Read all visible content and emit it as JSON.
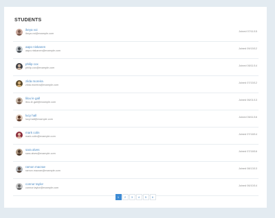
{
  "title": "STUDENTS",
  "students": [
    {
      "name": "ikeya voi",
      "email": "ikeya.voi@example.com",
      "joined": "Joined 07/11/15",
      "avatar_bg": "#c9a89c",
      "avatar_fg": "#7a5a4e"
    },
    {
      "name": "aapo niskanen",
      "email": "aapo.niskanen@example.com",
      "joined": "Joined 09/15/12",
      "avatar_bg": "#c3c8cc",
      "avatar_fg": "#4c5258"
    },
    {
      "name": "philip cox",
      "email": "philip.cox@example.com",
      "joined": "Joined 06/11/14",
      "avatar_bg": "#3e3f43",
      "avatar_fg": "#c9b09c"
    },
    {
      "name": "zilda moreira",
      "email": "zilda.moreira@example.com",
      "joined": "Joined 07/15/12",
      "avatar_bg": "#5c4a2b",
      "avatar_fg": "#d4b07a"
    },
    {
      "name": "lilou le gall",
      "email": "lilou.le.gall@example.com",
      "joined": "Joined 06/01/13",
      "avatar_bg": "#c7b6a6",
      "avatar_fg": "#6e5646"
    },
    {
      "name": "lucy hall",
      "email": "lucy.hall@example.com",
      "joined": "Joined 06/11/16",
      "avatar_bg": "#d9c4b4",
      "avatar_fg": "#5d3a2a"
    },
    {
      "name": "mark colin",
      "email": "mark.colin@example.com",
      "joined": "Joined 07/18/14",
      "avatar_bg": "#8a2a3a",
      "avatar_fg": "#e2b8a6"
    },
    {
      "name": "sara alves",
      "email": "sara.alves@example.com",
      "joined": "Joined 07/18/16",
      "avatar_bg": "#b09a84",
      "avatar_fg": "#4e3a2c"
    },
    {
      "name": "ramon macrae",
      "email": "ramon.macrae@example.com",
      "joined": "Joined 08/13/13",
      "avatar_bg": "#b4b8bc",
      "avatar_fg": "#5a4a42"
    },
    {
      "name": "connor taylor",
      "email": "connor.taylor@example.com",
      "joined": "Joined 06/10/14",
      "avatar_bg": "#c6c6c6",
      "avatar_fg": "#6a6a6a"
    }
  ],
  "pagination": {
    "pages": [
      "1",
      "2",
      "3",
      "4",
      "5",
      "6"
    ],
    "active": "1"
  },
  "colors": {
    "accent": "#3d8bd4",
    "link": "#4a8ac4",
    "background": "#e3ebf1"
  }
}
